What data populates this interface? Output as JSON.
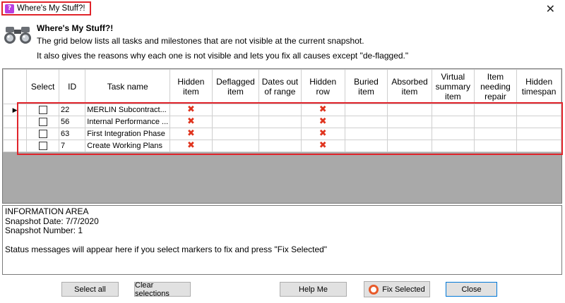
{
  "window": {
    "title": "Where's My Stuff?!",
    "close_glyph": "✕",
    "app_icon_glyph": "?"
  },
  "header": {
    "title": "Where's My Stuff?!",
    "line1": "The grid below lists all tasks and milestones that are not visible at the current snapshot.",
    "line2": "It also gives the reasons why each one is not visible and lets you fix all causes except \"de-flagged.\""
  },
  "grid": {
    "columns": [
      "Select",
      "ID",
      "Task name",
      "Hidden item",
      "Deflagged item",
      "Dates out of range",
      "Hidden row",
      "Buried item",
      "Absorbed item",
      "Virtual summary item",
      "Item needing repair",
      "Hidden timespan"
    ],
    "current_row_marker": "▶",
    "x_glyph": "✖",
    "rows": [
      {
        "id": "22",
        "name": "MERLIN Subcontract...",
        "hidden_item": "✖",
        "hidden_row": "✖"
      },
      {
        "id": "56",
        "name": "Internal Performance ...",
        "hidden_item": "✖",
        "hidden_row": "✖"
      },
      {
        "id": "63",
        "name": "First Integration Phase",
        "hidden_item": "✖",
        "hidden_row": "✖"
      },
      {
        "id": "7",
        "name": "Create Working Plans",
        "hidden_item": "✖",
        "hidden_row": "✖"
      }
    ]
  },
  "info": {
    "heading": "INFORMATION AREA",
    "snapshot_date": "Snapshot Date: 7/7/2020",
    "snapshot_number": "Snapshot Number: 1",
    "status": "Status messages will appear here if you select markers to fix and press \"Fix Selected\""
  },
  "buttons": {
    "select_all": "Select all",
    "clear_selections": "Clear selections",
    "help_me": "Help Me",
    "fix_selected": "Fix Selected",
    "close": "Close"
  }
}
